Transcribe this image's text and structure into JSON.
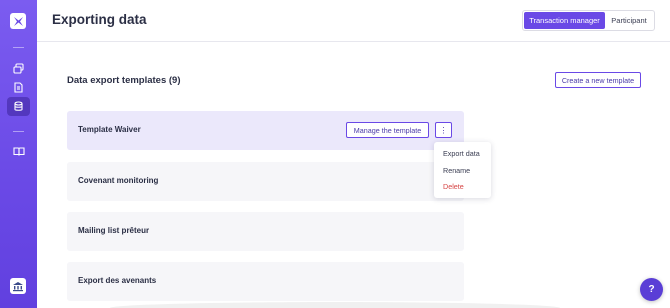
{
  "sidebar": {
    "logo_icon": "app-logo-icon",
    "items": [
      {
        "icon": "layers-icon",
        "active": false
      },
      {
        "icon": "document-icon",
        "active": false
      },
      {
        "icon": "database-icon",
        "active": true
      },
      {
        "icon": "book-icon",
        "active": false
      }
    ],
    "bottom_icon": "bank-icon"
  },
  "header": {
    "title": "Exporting data",
    "toggle": {
      "options": [
        "Transaction manager",
        "Participant"
      ],
      "selected": "Transaction manager"
    }
  },
  "main": {
    "section_title": "Data export templates (9)",
    "create_button": "Create a new template",
    "templates": [
      {
        "name": "Template Waiver"
      },
      {
        "name": "Covenant monitoring"
      },
      {
        "name": "Mailing list prêteur"
      },
      {
        "name": "Export des avenants"
      }
    ],
    "manage_button": "Manage the template",
    "kebab_label": "⋮",
    "context_menu": [
      "Export data",
      "Rename",
      "Delete"
    ]
  },
  "help_label": "?",
  "colors": {
    "accent": "#6a49e6",
    "sidebar": "#6f50ea",
    "danger": "#d64545",
    "card_bg": "#f6f6f9",
    "card_hover": "#ebe8fb"
  }
}
